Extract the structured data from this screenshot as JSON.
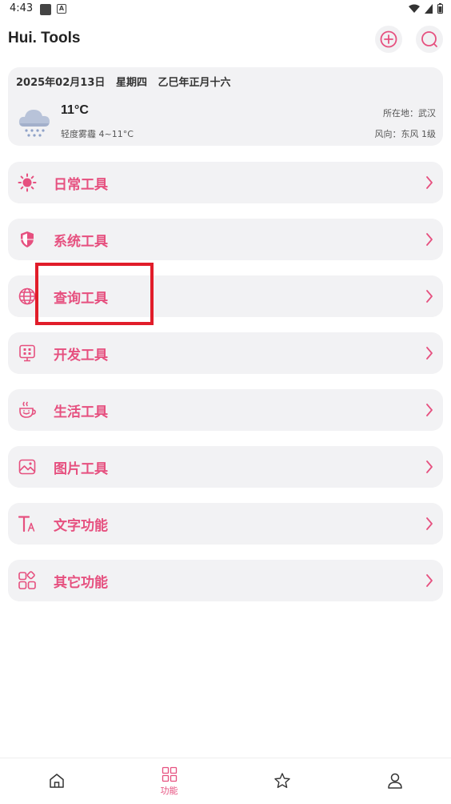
{
  "status_bar": {
    "time": "4:43",
    "a_icon_letter": "A"
  },
  "app": {
    "title": "Hui. Tools"
  },
  "weather": {
    "date": "2025年02月13日",
    "weekday": "星期四",
    "lunar": "乙巳年正月十六",
    "temperature": "11°C",
    "condition": "轻度雾霾 4~11°C",
    "location": "所在地：武汉",
    "wind": "风向：东风 1级"
  },
  "menu": {
    "items": [
      {
        "label": "日常工具",
        "icon": "sun-icon"
      },
      {
        "label": "系统工具",
        "icon": "shield-icon"
      },
      {
        "label": "查询工具",
        "icon": "globe-icon"
      },
      {
        "label": "开发工具",
        "icon": "monitor-icon"
      },
      {
        "label": "生活工具",
        "icon": "cup-icon"
      },
      {
        "label": "图片工具",
        "icon": "image-icon"
      },
      {
        "label": "文字功能",
        "icon": "text-icon"
      },
      {
        "label": "其它功能",
        "icon": "apps-icon"
      }
    ]
  },
  "bottom_nav": {
    "items": [
      {
        "label": "",
        "icon": "home-icon"
      },
      {
        "label": "功能",
        "icon": "grid-icon",
        "active": true
      },
      {
        "label": "",
        "icon": "star-icon"
      },
      {
        "label": "",
        "icon": "user-icon"
      }
    ]
  },
  "colors": {
    "accent": "#e6507f",
    "card_bg": "#f2f2f4",
    "highlight": "#e11d2a"
  }
}
